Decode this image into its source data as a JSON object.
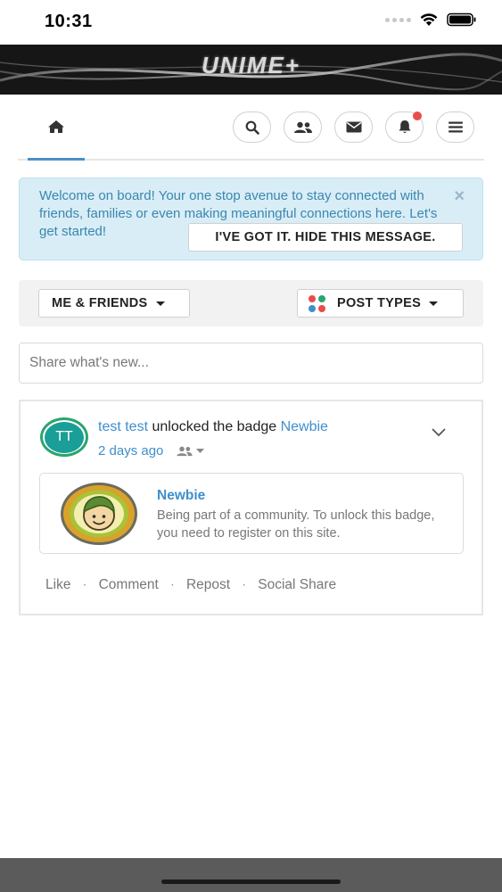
{
  "status_bar": {
    "time": "10:31"
  },
  "banner": {
    "title": "UNIME+"
  },
  "nav": {
    "home_icon": "home-icon",
    "icons": [
      "search-icon",
      "users-icon",
      "envelope-icon",
      "bell-icon",
      "menu-icon"
    ],
    "notification_color": "#e84c4c",
    "active_tab_color": "#4a90c8"
  },
  "alert": {
    "message": "Welcome on board! Your one stop avenue to stay connected with friends, families or even making meaningful connections here. Let's get started!",
    "close_symbol": "×",
    "dismiss_label": "I'VE GOT IT. HIDE THIS MESSAGE."
  },
  "filters": {
    "audience_label": "ME & FRIENDS",
    "post_types_label": "POST TYPES",
    "post_types_dot_colors": [
      "#e84c4c",
      "#2ba56c",
      "#3f8fcc",
      "#e84c4c"
    ]
  },
  "share": {
    "placeholder": "Share what's new..."
  },
  "post": {
    "avatar_initials": "TT",
    "author": "test test",
    "action_text": " unlocked the badge ",
    "badge_link": "Newbie",
    "time_ago": "2 days ago",
    "badge": {
      "title": "Newbie",
      "description": "Being part of a community. To unlock this badge, you need to register on this site."
    },
    "actions": {
      "like": "Like",
      "comment": "Comment",
      "repost": "Repost",
      "social_share": "Social Share",
      "separator": "·"
    }
  }
}
